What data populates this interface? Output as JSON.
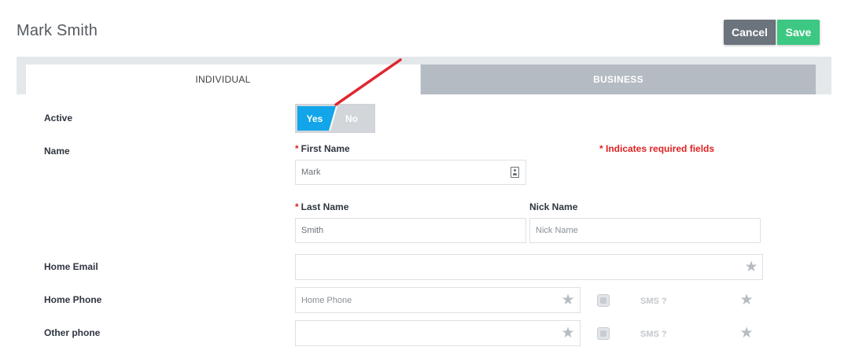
{
  "header": {
    "title": "Mark Smith",
    "cancel_label": "Cancel",
    "save_label": "Save"
  },
  "tabs": [
    {
      "label": "INDIVIDUAL",
      "active": true
    },
    {
      "label": "BUSINESS",
      "active": false
    }
  ],
  "form": {
    "active_label": "Active",
    "active_toggle": {
      "yes_label": "Yes",
      "no_label": "No",
      "selected": "Yes"
    },
    "name_label": "Name",
    "required_star": "*",
    "required_note": "* Indicates required fields",
    "first_name": {
      "label": "First Name",
      "value": "Mark"
    },
    "last_name": {
      "label": "Last Name",
      "value": "Smith"
    },
    "nick_name": {
      "label": "Nick Name",
      "placeholder": "Nick Name"
    },
    "home_email": {
      "label": "Home Email",
      "value": ""
    },
    "home_phone": {
      "label": "Home Phone",
      "placeholder": "Home Phone",
      "sms_label": "SMS ?"
    },
    "other_phone": {
      "label": "Other phone",
      "value": "",
      "sms_label": "SMS ?"
    }
  },
  "colors": {
    "accent_blue": "#12a5e9",
    "save_green": "#3cc882",
    "cancel_gray": "#6b737d",
    "required_red": "#e02020",
    "annotation_red": "#e0262e"
  },
  "icons": {
    "favorite": "star-icon",
    "contact_card": "contact-card-icon",
    "checkbox": "checkbox-icon"
  }
}
